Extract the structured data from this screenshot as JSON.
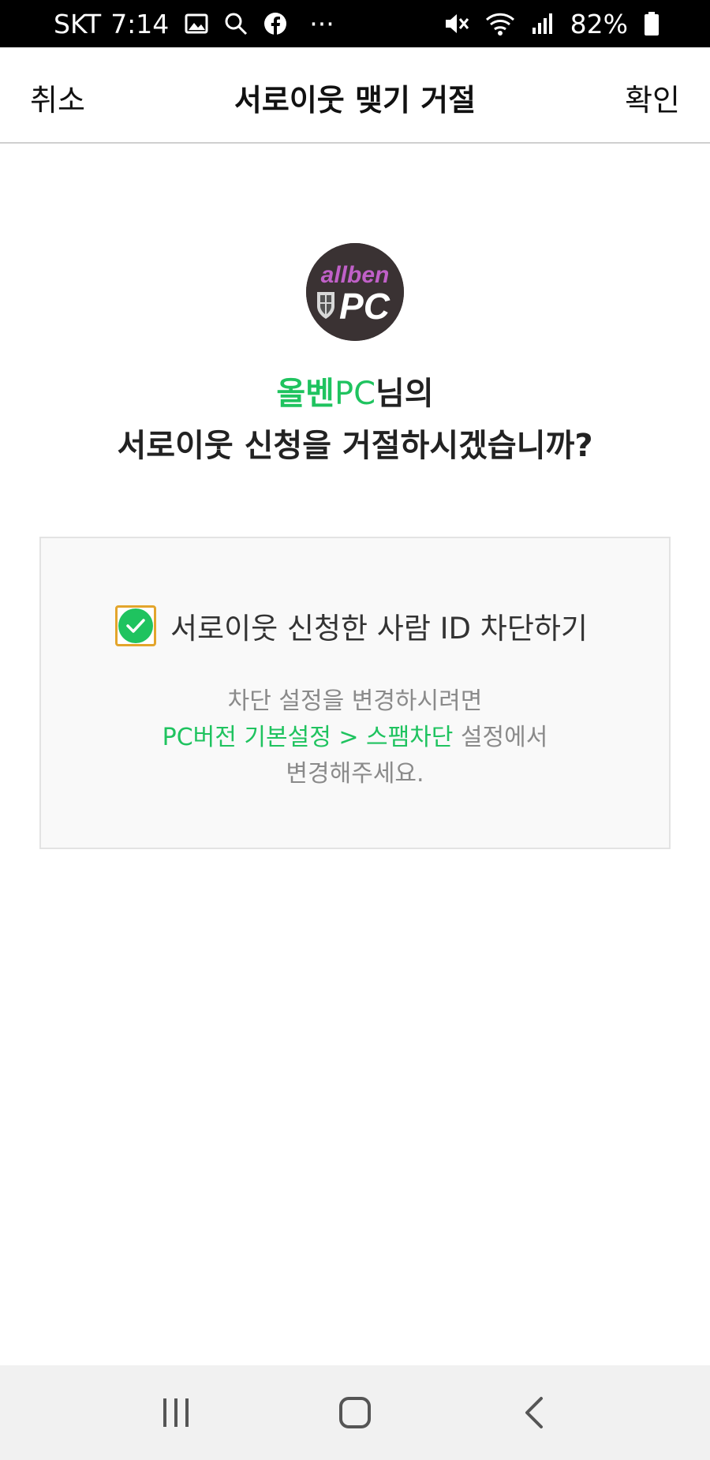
{
  "status_bar": {
    "carrier": "SKT",
    "time": "7:14",
    "battery": "82%",
    "more": "···"
  },
  "header": {
    "cancel_label": "취소",
    "title": "서로이웃 맺기 거절",
    "confirm_label": "확인"
  },
  "profile": {
    "avatar_text_top": "allben",
    "avatar_text_bottom": "PC"
  },
  "question": {
    "name_bold": "올벤",
    "name_rest": "PC",
    "suffix": "님의",
    "line2": "서로이웃 신청을 거절하시겠습니까?"
  },
  "block_option": {
    "label": "서로이웃 신청한 사람 ID 차단하기",
    "checked": true,
    "note_line1": "차단 설정을 변경하시려면",
    "note_path": "PC버전 기본설정 > 스팸차단",
    "note_line2_rest": " 설정에서",
    "note_line3": "변경해주세요."
  },
  "colors": {
    "accent_green": "#1fc35f",
    "checkbox_border": "#e3a52c"
  },
  "icons": {
    "status": [
      "gallery-icon",
      "search-icon",
      "facebook-icon",
      "mute-icon",
      "wifi-icon",
      "signal-icon",
      "battery-icon"
    ],
    "nav": [
      "recents-icon",
      "home-icon",
      "back-icon"
    ]
  }
}
